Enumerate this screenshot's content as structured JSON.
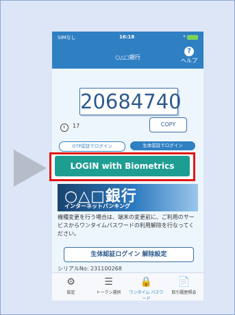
{
  "status": {
    "carrier": "SIMなし",
    "time": "16:18",
    "bluetooth": "*"
  },
  "nav": {
    "title": "○△□銀行",
    "help_label": "ヘルプ",
    "help_icon": "?"
  },
  "otp": {
    "code": "20684740",
    "timer": "17",
    "copy_label": "COPY"
  },
  "tabs": {
    "otp_login": "OTP認証でログイン",
    "bio_login": "生体認証でログイン"
  },
  "login": {
    "label": "LOGIN with Biometrics"
  },
  "banner": {
    "bank": "○△□銀行",
    "sub": "インターネットバンキング"
  },
  "notice": "機種変更を行う場合は、端末の変更前に、ご利用のサービスからワンタイムパスワードの利用解除を行なってください。",
  "unset_label": "生体認証ログイン 解除設定",
  "serial": "シリアルNo: 231100268",
  "tabbar": [
    {
      "label": "設定",
      "icon": "gear-icon"
    },
    {
      "label": "トークン選択",
      "icon": "list-icon"
    },
    {
      "label": "ワンタイム パスワード",
      "icon": "lock-icon"
    },
    {
      "label": "取引履歴照会",
      "icon": "document-icon"
    }
  ],
  "colors": {
    "accent": "#2f7fc3",
    "login_button": "#1e9e92",
    "highlight": "#e3140f",
    "frame_bg": "#dce6f7"
  }
}
